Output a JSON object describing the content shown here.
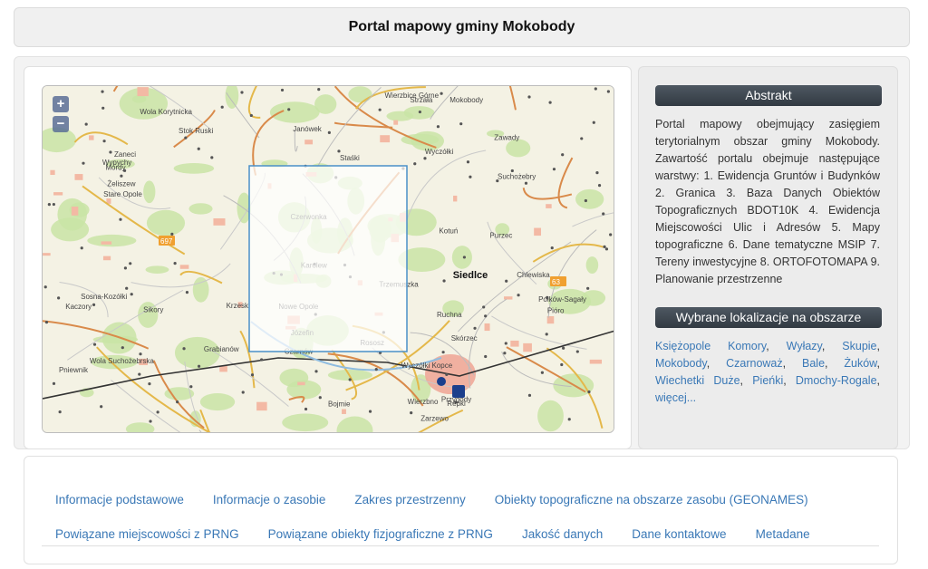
{
  "header": {
    "title": "Portal mapowy gminy Mokobody"
  },
  "map": {
    "zoom_in": "+",
    "zoom_out": "−",
    "labels": [
      "Wola Korytnicka",
      "Zawady",
      "Wypychy",
      "Ruchna",
      "Karolew",
      "Zaneci",
      "Repki",
      "Wierzbice Górne",
      "Czerwonka",
      "Staśki",
      "Wierzbno",
      "Janówek",
      "Czarnów",
      "Połków-Sagały",
      "Józefin",
      "Mokobody",
      "Kotuń",
      "Siedlce",
      "Suchożebry",
      "Nowe Opole",
      "Przygody",
      "Wola Suchożebrska",
      "Krzesk",
      "Wyczółki",
      "Strzała",
      "Skórzec",
      "Kaczory",
      "Mordy",
      "Żeliszew",
      "Pióro",
      "Rososz",
      "Trzemuszka",
      "Chlewiska",
      "Bojmie",
      "Zarzewo",
      "Sikory",
      "Stok Ruski",
      "Wyczółki Kopce",
      "Stare Opole",
      "Sosna-Kozółki",
      "Purzec",
      "Pniewnik",
      "Grabianów"
    ],
    "badges": [
      "697",
      "63"
    ]
  },
  "abstract": {
    "title": "Abstrakt",
    "text": "Portal mapowy obejmujący zasięgiem terytorialnym obszar gminy Mokobody. Zawartość portalu obejmuje następujące warstwy: 1. Ewidencja Gruntów i Budynków 2. Granica 3. Baza Danych Obiektów Topograficznych BDOT10K 4. Ewidencja Miejscowości Ulic i Adresów 5. Mapy topograficzne 6. Dane tematyczne MSIP 7. Tereny inwestycyjne 8. ORTOFOTOMAPA 9. Planowanie przestrzenne"
  },
  "locations": {
    "title": "Wybrane lokalizacje na obszarze",
    "items": [
      "Księżopole Komory",
      "Wyłazy",
      "Skupie",
      "Mokobody",
      "Czarnoważ",
      "Bale",
      "Żuków",
      "Wiechetki Duże",
      "Pieńki",
      "Dmochy-Rogale"
    ],
    "more": "więcej..."
  },
  "nav": {
    "row1": [
      "Informacje podstawowe",
      "Informacje o zasobie",
      "Zakres przestrzenny",
      "Obiekty topograficzne na obszarze zasobu (GEONAMES)"
    ],
    "row2": [
      "Powiązane miejscowości z PRNG",
      "Powiązane obiekty fizjograficzne z PRNG",
      "Jakość danych",
      "Dane kontaktowe",
      "Metadane"
    ]
  },
  "colors": {
    "accent_link": "#3a78b6",
    "title_bar": "#3a434c",
    "extent_box": "#4a90c8"
  }
}
